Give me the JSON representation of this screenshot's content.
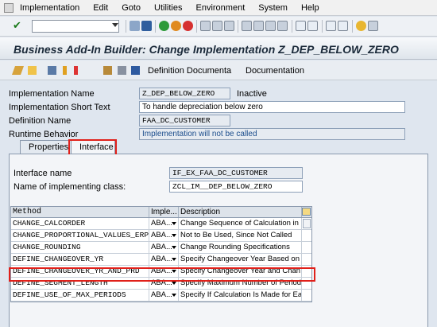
{
  "menu": [
    "Implementation",
    "Edit",
    "Goto",
    "Utilities",
    "Environment",
    "System",
    "Help"
  ],
  "header": {
    "title": "Business Add-In Builder: Change Implementation Z_DEP_BELOW_ZERO"
  },
  "app_toolbar": {
    "definition_documenta": "Definition Documenta",
    "documentation": "Documentation"
  },
  "form": {
    "impl_name_label": "Implementation Name",
    "impl_name_value": "Z_DEP_BELOW_ZERO",
    "impl_status": "Inactive",
    "short_text_label": "Implementation Short Text",
    "short_text_value": "To handle depreciation below zero",
    "def_name_label": "Definition Name",
    "def_name_value": "FAA_DC_CUSTOMER",
    "runtime_label": "Runtime Behavior",
    "runtime_value": "Implementation will not be called"
  },
  "tabs": {
    "properties": "Properties",
    "interface": "Interface"
  },
  "interface": {
    "name_label": "Interface name",
    "name_value": "IF_EX_FAA_DC_CUSTOMER",
    "class_label": "Name of implementing class:",
    "class_value": "ZCL_IM__DEP_BELOW_ZERO"
  },
  "table": {
    "columns": [
      "Method",
      "Imple...",
      "Description"
    ],
    "rows": [
      {
        "method": "CHANGE_CALCORDER",
        "impl": "ABA...",
        "desc": "Change Sequence of Calculation in"
      },
      {
        "method": "CHANGE_PROPORTIONAL_VALUES_ERP",
        "impl": "ABA...",
        "desc": "Not to Be Used, Since Not Called"
      },
      {
        "method": "CHANGE_ROUNDING",
        "impl": "ABA...",
        "desc": "Change Rounding Specifications"
      },
      {
        "method": "DEFINE_CHANGEOVER_YR",
        "impl": "ABA...",
        "desc": "Specify Changeover Year Based on"
      },
      {
        "method": "DEFINE_CHANGEOVER_YR_AND_PRD",
        "impl": "ABA...",
        "desc": "Specify Changeover Year and Chan"
      },
      {
        "method": "DEFINE_SEGMENT_LENGTH",
        "impl": "ABA...",
        "desc": "Specify Maximum Number of Periods"
      },
      {
        "method": "DEFINE_USE_OF_MAX_PERIODS",
        "impl": "ABA...",
        "desc": "Specify If Calculation Is Made for Ea"
      }
    ]
  },
  "colors": {
    "highlight": "#e0201a",
    "title_text": "#1b2a3a"
  }
}
